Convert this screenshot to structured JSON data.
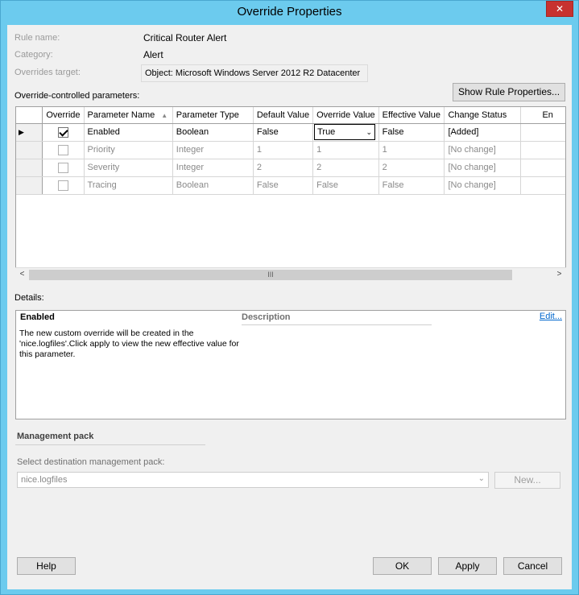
{
  "window": {
    "title": "Override Properties",
    "close_glyph": "✕"
  },
  "header": {
    "rule_name_label": "Rule name:",
    "rule_name_value": "Critical Router Alert",
    "category_label": "Category:",
    "category_value": "Alert",
    "overrides_target_label": "Overrides target:",
    "overrides_target_value": "Object: Microsoft Windows Server 2012 R2 Datacenter"
  },
  "parameters": {
    "section_label": "Override-controlled parameters:",
    "show_rule_properties_label": "Show Rule Properties...",
    "columns": [
      "Override",
      "Parameter Name",
      "Parameter Type",
      "Default Value",
      "Override Value",
      "Effective Value",
      "Change Status",
      "En"
    ],
    "sorted_column": "Parameter Name",
    "sort_glyph": "▲",
    "current_row_glyph": "▶",
    "rows": [
      {
        "override": true,
        "name": "Enabled",
        "type": "Boolean",
        "default": "False",
        "override_value": "True",
        "effective": "False",
        "status": "[Added]",
        "enabled": true,
        "current": true
      },
      {
        "override": false,
        "name": "Priority",
        "type": "Integer",
        "default": "1",
        "override_value": "1",
        "effective": "1",
        "status": "[No change]",
        "enabled": false,
        "current": false
      },
      {
        "override": false,
        "name": "Severity",
        "type": "Integer",
        "default": "2",
        "override_value": "2",
        "effective": "2",
        "status": "[No change]",
        "enabled": false,
        "current": false
      },
      {
        "override": false,
        "name": "Tracing",
        "type": "Boolean",
        "default": "False",
        "override_value": "False",
        "effective": "False",
        "status": "[No change]",
        "enabled": false,
        "current": false
      }
    ],
    "scroll_left_glyph": "<",
    "scroll_right_glyph": ">",
    "scroll_thumb_glyph": "III"
  },
  "details": {
    "label": "Details:",
    "heading": "Enabled",
    "description_heading": "Description",
    "edit_link": "Edit...",
    "text": "The new custom override will be created in the 'nice.logfiles'.Click apply to view  the new effective value for this parameter."
  },
  "management_pack": {
    "heading": "Management pack",
    "select_label": "Select destination management pack:",
    "selected_value": "nice.logfiles",
    "dropdown_glyph": "⌄",
    "new_button_label": "New..."
  },
  "footer": {
    "help_label": "Help",
    "ok_label": "OK",
    "apply_label": "Apply",
    "cancel_label": "Cancel"
  },
  "colors": {
    "title_bar": "#6ccbee",
    "close_button": "#c7322f",
    "client_background": "#f0f0f0",
    "link": "#0066cc"
  }
}
